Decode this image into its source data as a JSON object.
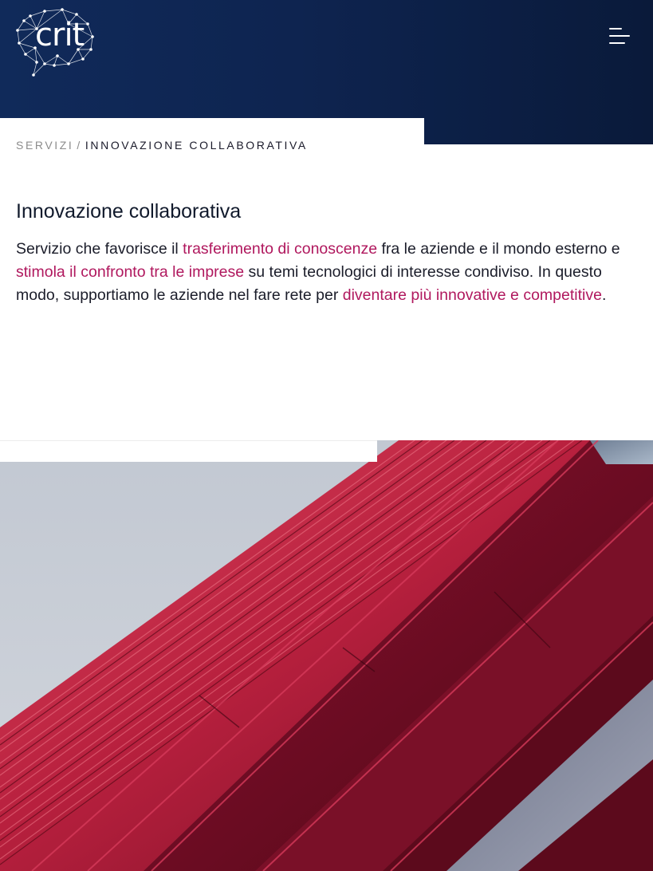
{
  "header": {
    "logo_text": "crit",
    "menu_icon": "hamburger-menu-icon",
    "background": "#0e2450"
  },
  "breadcrumb": {
    "parent": "SERVIZI",
    "separator": "/",
    "current": "INNOVAZIONE COLLABORATIVA"
  },
  "main": {
    "title": "Innovazione collaborativa",
    "intro": {
      "part1": "Servizio che favorisce il ",
      "highlight1": "trasferimento di conoscenze",
      "part2": " fra le aziende e il mondo esterno e ",
      "highlight2": "stimola il confronto tra le imprese",
      "part3": " su temi tecnologici di interesse condiviso. In questo modo, supportiamo le aziende nel fare rete per ",
      "highlight3": "diventare più innovative e competitive",
      "part4": "."
    }
  },
  "hero_image": {
    "subject": "red-metal-facade-photo"
  },
  "colors": {
    "accent": "#b0185e",
    "header_blue": "#0e2450",
    "text_dark": "#1b1d2a",
    "breadcrumb_grey": "#8c8c8c"
  }
}
